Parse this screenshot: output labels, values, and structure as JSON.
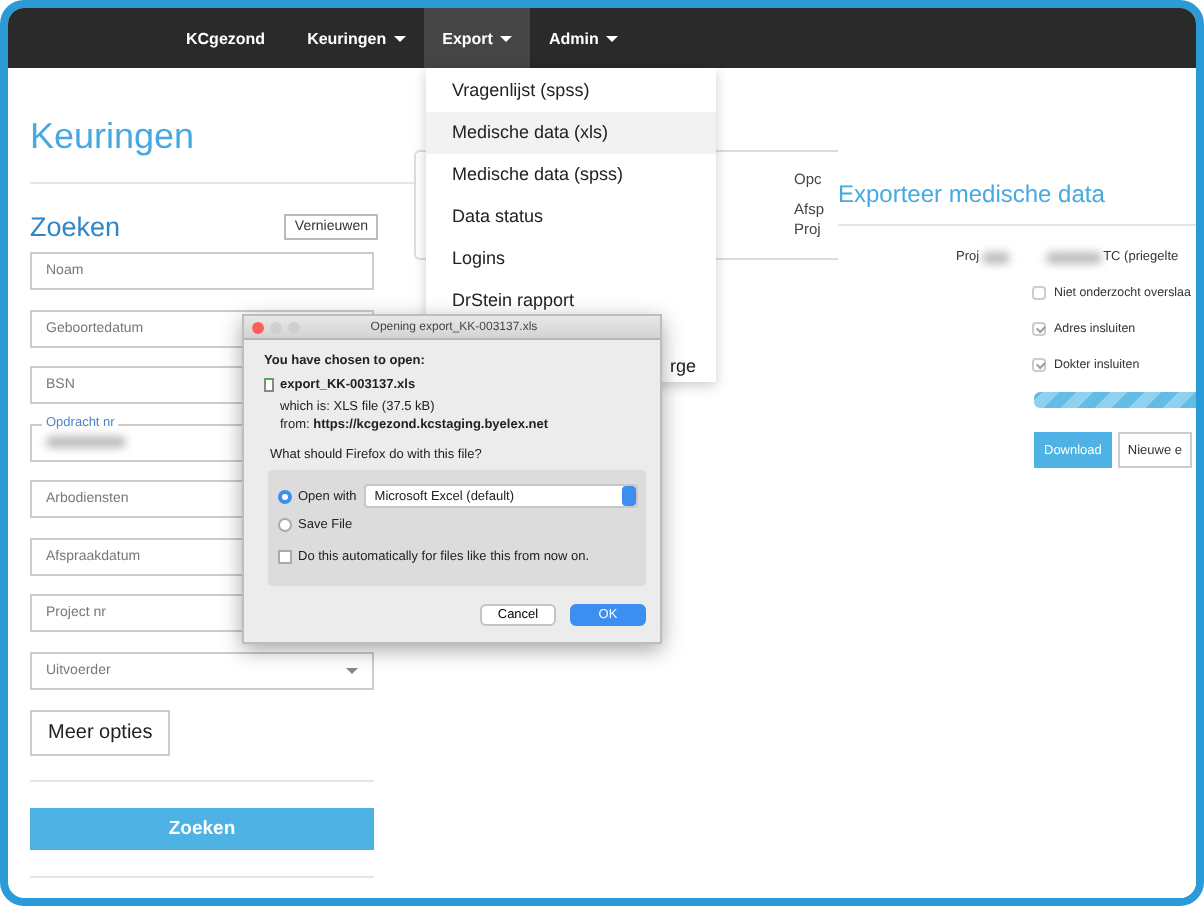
{
  "navbar": {
    "brand": "KCgezond",
    "items": [
      {
        "label": "Keuringen",
        "selected": false
      },
      {
        "label": "Export",
        "selected": true
      },
      {
        "label": "Admin",
        "selected": false
      }
    ]
  },
  "export_menu": {
    "items": [
      {
        "label": "Vragenlijst (spss)",
        "selected": false
      },
      {
        "label": "Medische data (xls)",
        "selected": true
      },
      {
        "label": "Medische data (spss)",
        "selected": false
      },
      {
        "label": "Data status",
        "selected": false
      },
      {
        "label": "Logins",
        "selected": false
      },
      {
        "label": "DrStein rapport",
        "selected": false
      },
      {
        "label": "rge",
        "selected": false
      }
    ]
  },
  "page": {
    "title": "Keuringen"
  },
  "search": {
    "title": "Zoeken",
    "refresh_button": "Vernieuwen",
    "fields": [
      {
        "kind": "input",
        "placeholder": "Noam"
      },
      {
        "kind": "input",
        "placeholder": "Geboortedatum"
      },
      {
        "kind": "input",
        "placeholder": "BSN"
      },
      {
        "kind": "floating",
        "label": "Opdracht nr"
      },
      {
        "kind": "input",
        "placeholder": "Arbodiensten"
      },
      {
        "kind": "input",
        "placeholder": "Afspraakdatum"
      },
      {
        "kind": "input",
        "placeholder": "Project nr"
      },
      {
        "kind": "select",
        "placeholder": "Uitvoerder"
      }
    ],
    "more_button": "Meer opties",
    "submit_button": "Zoeken"
  },
  "result_card": {
    "lines": [
      "Opc",
      "Afsp",
      "Proj"
    ]
  },
  "dialog": {
    "title": "Opening export_KK-003137.xls",
    "heading": "You have chosen to open:",
    "filename": "export_KK-003137.xls",
    "which_is": "which is:  XLS file (37.5 kB)",
    "from": "from:  **https://kcgezond.kcstaging.byelex.net**",
    "question": "What should Firefox do with this file?",
    "options": [
      {
        "label": "Open with",
        "selected": true,
        "kind": "app"
      },
      {
        "label": "Save File",
        "selected": false,
        "kind": "plain"
      }
    ],
    "app": "Microsoft Excel (default)",
    "auto": {
      "label": "Do this automatically for files like this from now on.",
      "checked": false
    },
    "buttons": [
      {
        "label": "Cancel",
        "kind": "default"
      },
      {
        "label": "OK",
        "kind": "primary"
      }
    ]
  },
  "export_panel": {
    "title": "Exporteer medische data",
    "project_label": "Proj",
    "project_value": "TC (priegelte",
    "checkboxes": [
      {
        "label": "Niet onderzocht overslaa",
        "checked": false
      },
      {
        "label": "Adres insluiten",
        "checked": true
      },
      {
        "label": "Dokter insluiten",
        "checked": true
      }
    ],
    "progress": {
      "level": 1
    },
    "buttons": [
      {
        "label": "Download",
        "kind": "primary"
      },
      {
        "label": "Nieuwe e",
        "kind": "default"
      }
    ]
  }
}
